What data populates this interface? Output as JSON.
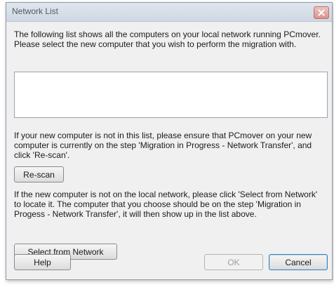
{
  "window": {
    "title": "Network List",
    "close_icon": "close-icon"
  },
  "content": {
    "intro": "The following list shows all the computers on your local network running PCmover.  Please select the new computer that you wish to perform the migration with.",
    "computers": [],
    "not_in_list_text": "If your new computer is not in this list, please ensure that PCmover on your new computer is currently on the step 'Migration in Progress - Network Transfer', and click 'Re-scan'.",
    "not_on_network_text": "If the new computer is not on the local network, please click 'Select from Network' to locate it.  The computer that you choose should be on the step 'Migration in Progess - Network Transfer', it will then show up in the list above."
  },
  "buttons": {
    "rescan": "Re-scan",
    "select_from_network": "Select from Network",
    "help": "Help",
    "ok": "OK",
    "cancel": "Cancel"
  },
  "colors": {
    "close_button": "#d9938c",
    "default_button_border": "#3c7fb1"
  }
}
